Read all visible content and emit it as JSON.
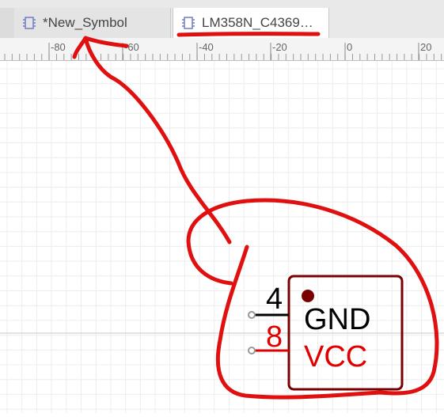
{
  "tabs": [
    {
      "label": "*New_Symbol",
      "icon": "chip-icon",
      "active": false
    },
    {
      "label": "LM358N_C4369…",
      "icon": "chip-icon",
      "active": true
    }
  ],
  "ruler": {
    "ticks": [
      "-80",
      "-60",
      "-40",
      "-20",
      "0",
      "20"
    ]
  },
  "symbol": {
    "pins": [
      {
        "number": "4",
        "name": "GND",
        "color": "#000000"
      },
      {
        "number": "8",
        "name": "VCC",
        "color": "#e00000"
      }
    ],
    "body_color": "#7a0000"
  },
  "annotation_color": "#e01010"
}
